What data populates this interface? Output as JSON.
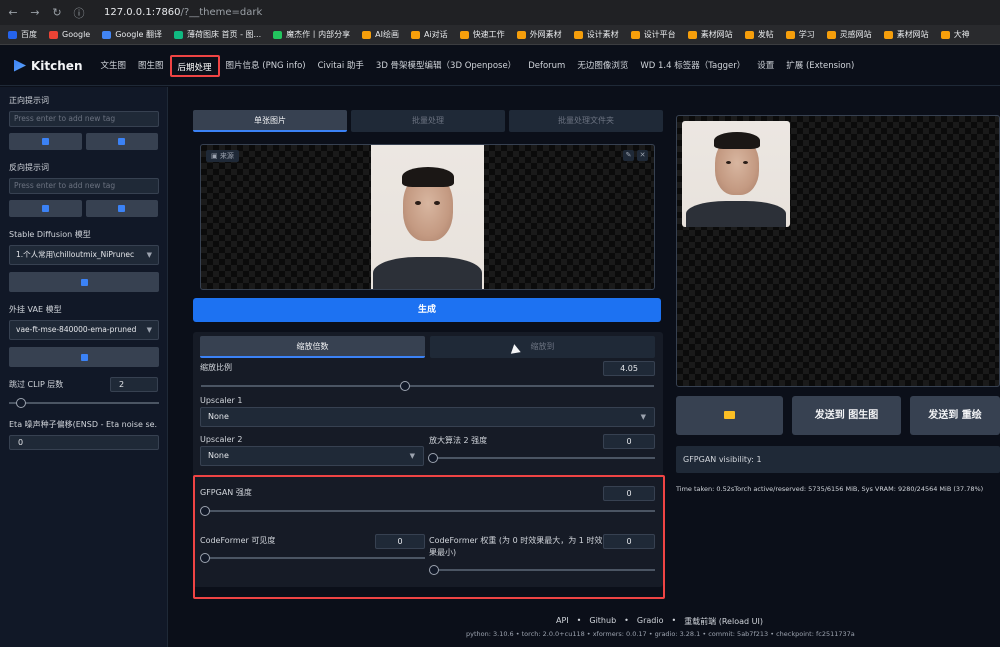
{
  "browser": {
    "url": "127.0.0.1:7860",
    "url_suffix": "/?__theme=dark",
    "back_icon": "arrow-left-icon",
    "forward_icon": "arrow-right-icon",
    "reload_icon": "reload-icon",
    "bookmarks": [
      {
        "label": "百度",
        "color": "#2563eb"
      },
      {
        "label": "Google",
        "color": "#ea4335"
      },
      {
        "label": "Google 翻译",
        "color": "#4285f4"
      },
      {
        "label": "薄荷图床 首页 - 图...",
        "color": "#10b981"
      },
      {
        "label": "魔杰作丨内部分享",
        "color": "#22c55e"
      },
      {
        "label": "AI绘画",
        "color": "#f59e0b"
      },
      {
        "label": "Ai对话",
        "color": "#f59e0b"
      },
      {
        "label": "快速工作",
        "color": "#f59e0b"
      },
      {
        "label": "外网素材",
        "color": "#f59e0b"
      },
      {
        "label": "设计素材",
        "color": "#f59e0b"
      },
      {
        "label": "设计平台",
        "color": "#f59e0b"
      },
      {
        "label": "素材网站",
        "color": "#f59e0b"
      },
      {
        "label": "发帖",
        "color": "#f59e0b"
      },
      {
        "label": "学习",
        "color": "#f59e0b"
      },
      {
        "label": "灵感网站",
        "color": "#f59e0b"
      },
      {
        "label": "素材网站",
        "color": "#f59e0b"
      },
      {
        "label": "大神",
        "color": "#f59e0b"
      }
    ]
  },
  "app": {
    "logo": "Kitchen",
    "tabs": [
      "文生图",
      "图生图",
      "后期处理",
      "图片信息 (PNG info)",
      "Civitai 助手",
      "3D 骨架模型编辑（3D Openpose）",
      "Deforum",
      "无边图像浏览",
      "WD 1.4 标签器（Tagger）",
      "设置",
      "扩展 (Extension)"
    ],
    "active_tab": "后期处理"
  },
  "left": {
    "pos_prompt_label": "正向提示词",
    "pos_prompt_placeholder": "Press enter to add new tag",
    "neg_prompt_label": "反向提示词",
    "neg_prompt_placeholder": "Press enter to add new tag",
    "sd_model_label": "Stable Diffusion 模型",
    "sd_model_value": "1.个人常用\\chilloutmix_NiPrunec",
    "vae_label": "外挂 VAE 模型",
    "vae_value": "vae-ft-mse-840000-ema-pruned",
    "clip_label": "跳过 CLIP 层数",
    "clip_value": "2",
    "clip_fraction": 0.08,
    "eta_label": "Eta 噪声种子偏移(ENSD - Eta noise se...",
    "eta_value": "0"
  },
  "center": {
    "subtabs": [
      "单张图片",
      "批量处理",
      "批量处理文件夹"
    ],
    "active_subtab": "单张图片",
    "source_label": "来源",
    "generate_label": "生成",
    "scale_tabs": [
      "缩放倍数",
      "缩放到"
    ],
    "active_scale_tab": "缩放倍数",
    "resize_label": "缩放比例",
    "resize_value": "4.05",
    "resize_fraction": 0.45,
    "upscaler1_label": "Upscaler 1",
    "upscaler1_value": "None",
    "upscaler2_label": "Upscaler 2",
    "upscaler2_value": "None",
    "upscaler2_vis_label": "放大算法 2 强度",
    "upscaler2_vis_value": "0",
    "gfpgan_label": "GFPGAN 强度",
    "gfpgan_value": "0",
    "codeformer_vis_label": "CodeFormer 可见度",
    "codeformer_vis_value": "0",
    "codeformer_weight_label": "CodeFormer 权重 (为 0 时效果最大，为 1 时效果最小)",
    "codeformer_weight_value": "0"
  },
  "right": {
    "folder_icon": "folder-icon",
    "send_img2img": "发送到 图生图",
    "send_inpaint": "发送到 重绘",
    "gfpgan_visibility": "GFPGAN visibility: 1",
    "time_taken": "Time taken: 0.52sTorch active/reserved: 5735/6156 MiB, Sys VRAM: 9280/24564 MiB (37.78%)"
  },
  "footer": {
    "links": [
      "API",
      "•",
      "Github",
      "•",
      "Gradio",
      "•",
      "重载前端 (Reload UI)"
    ],
    "info": "python: 3.10.6  •  torch: 2.0.0+cu118  •  xformers: 0.0.17  •  gradio: 3.28.1  •  commit: 5ab7f213  •  checkpoint: fc2511737a"
  },
  "colors": {
    "accent": "#1d72f2",
    "highlight": "#ef4444",
    "background": "#0b0f19"
  }
}
